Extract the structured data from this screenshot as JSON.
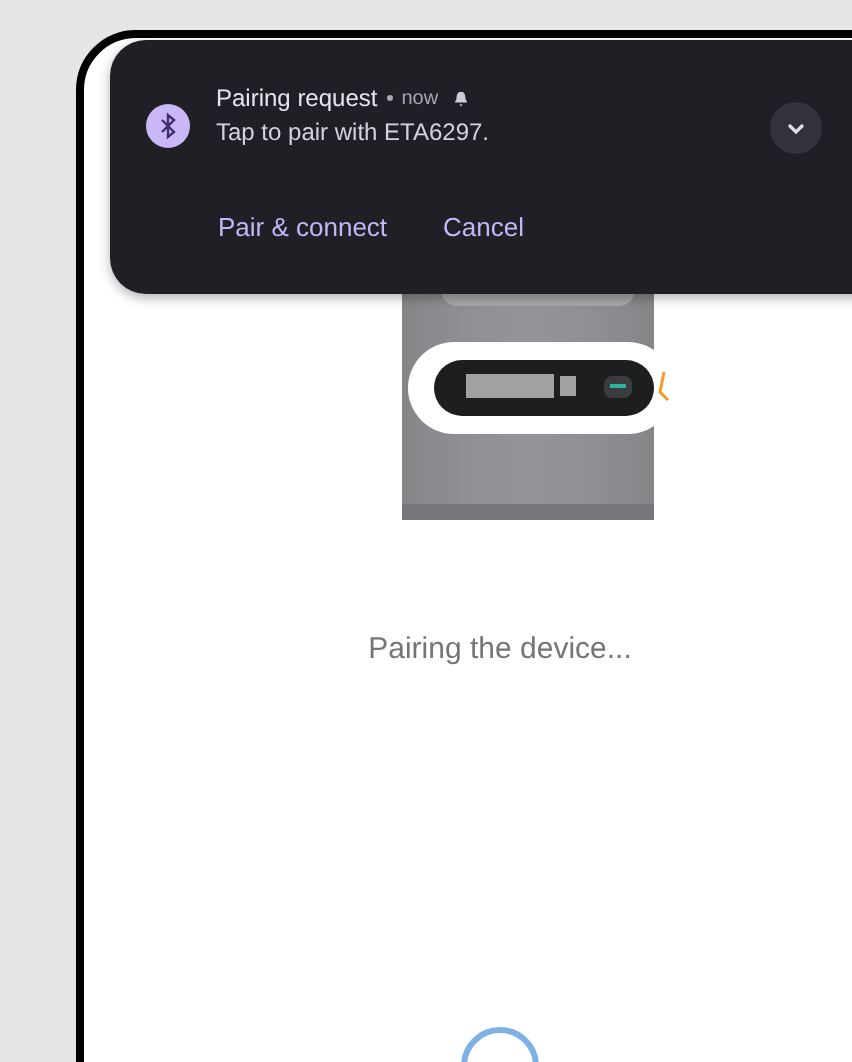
{
  "notification": {
    "title": "Pairing request",
    "time": "now",
    "message": "Tap to pair with ETA6297.",
    "actions": [
      "Pair & connect",
      "Cancel"
    ]
  },
  "status": "Pairing the device..."
}
